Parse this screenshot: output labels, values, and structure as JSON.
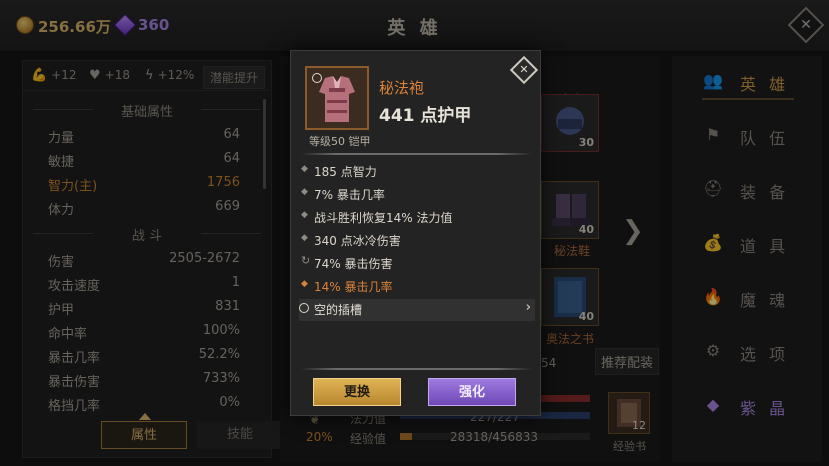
{
  "topbar": {
    "gold": "256.66万",
    "gems": "360",
    "title": "英 雄"
  },
  "left": {
    "buffs": [
      "+12",
      "+18",
      "+12%"
    ],
    "potential_button": "潜能提升",
    "basic_header": "基础属性",
    "basic": [
      {
        "k": "力量",
        "v": "64"
      },
      {
        "k": "敏捷",
        "v": "64"
      },
      {
        "k": "智力(主)",
        "v": "1756"
      },
      {
        "k": "体力",
        "v": "669"
      }
    ],
    "combat_header": "战 斗",
    "combat": [
      {
        "k": "伤害",
        "v": "2505-2672"
      },
      {
        "k": "攻击速度",
        "v": "1"
      },
      {
        "k": "护甲",
        "v": "831"
      },
      {
        "k": "命中率",
        "v": "100%"
      },
      {
        "k": "暴击几率",
        "v": "52.2%"
      },
      {
        "k": "暴击伤害",
        "v": "733%"
      },
      {
        "k": "格挡几率",
        "v": "0%"
      }
    ],
    "tabs": [
      "属性",
      "技能"
    ]
  },
  "middle": {
    "slots": [
      {
        "level": "30"
      },
      {
        "level": "40",
        "name": "秘法鞋"
      },
      {
        "level": "40",
        "name": "奥法之书"
      }
    ],
    "partial_number": "54",
    "recommend": "推荐配装",
    "bars": {
      "mana_label": "法力值",
      "mana_value": "227/227",
      "exp_label": "经验值",
      "exp_value": "28318/456833",
      "exp_progress": 0.062
    },
    "percent": "20%",
    "book_count": "12",
    "book_name": "经验书"
  },
  "nav": [
    {
      "label": "英 雄",
      "icon": "hero-icon"
    },
    {
      "label": "队 伍",
      "icon": "flag-icon"
    },
    {
      "label": "装 备",
      "icon": "helmet-icon"
    },
    {
      "label": "道 具",
      "icon": "bag-icon"
    },
    {
      "label": "魔 魂",
      "icon": "flame-icon"
    },
    {
      "label": "选 项",
      "icon": "gear-icon"
    },
    {
      "label": "紫 晶",
      "icon": "crystal-icon"
    }
  ],
  "popup": {
    "name": "秘法袍",
    "armor": "441 点护甲",
    "level_type": "等级50 铠甲",
    "stats": [
      "185 点智力",
      "7% 暴击几率",
      "战斗胜利恢复14% 法力值",
      "340 点冰冷伤害",
      "74% 暴击伤害",
      "14% 暴击几率"
    ],
    "socket": "空的插槽",
    "btn_replace": "更换",
    "btn_enhance": "强化"
  }
}
